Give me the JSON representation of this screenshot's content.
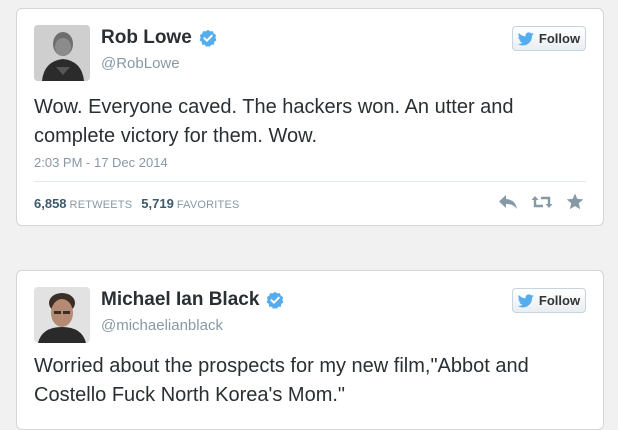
{
  "colors": {
    "page_bg": "#f1f1f1",
    "card_bg": "#ffffff",
    "text": "#292f33",
    "muted": "#8899a6",
    "verified_blue": "#55acee",
    "action_gray": "#8899a6"
  },
  "tweets": [
    {
      "name": "Rob Lowe",
      "handle": "@RobLowe",
      "verified": true,
      "follow_label": "Follow",
      "text": "Wow. Everyone caved. The hackers won. An utter and complete victory for them. Wow.",
      "timestamp": "2:03 PM - 17 Dec 2014",
      "retweets": "6,858",
      "retweets_label": "RETWEETS",
      "favorites": "5,719",
      "favorites_label": "FAVORITES",
      "icons": [
        "reply-icon",
        "retweet-icon",
        "favorite-icon"
      ]
    },
    {
      "name": "Michael Ian Black",
      "handle": "@michaelianblack",
      "verified": true,
      "follow_label": "Follow",
      "text": "Worried about the prospects for my new film,\"Abbot and Costello Fuck North Korea's Mom.\""
    }
  ]
}
